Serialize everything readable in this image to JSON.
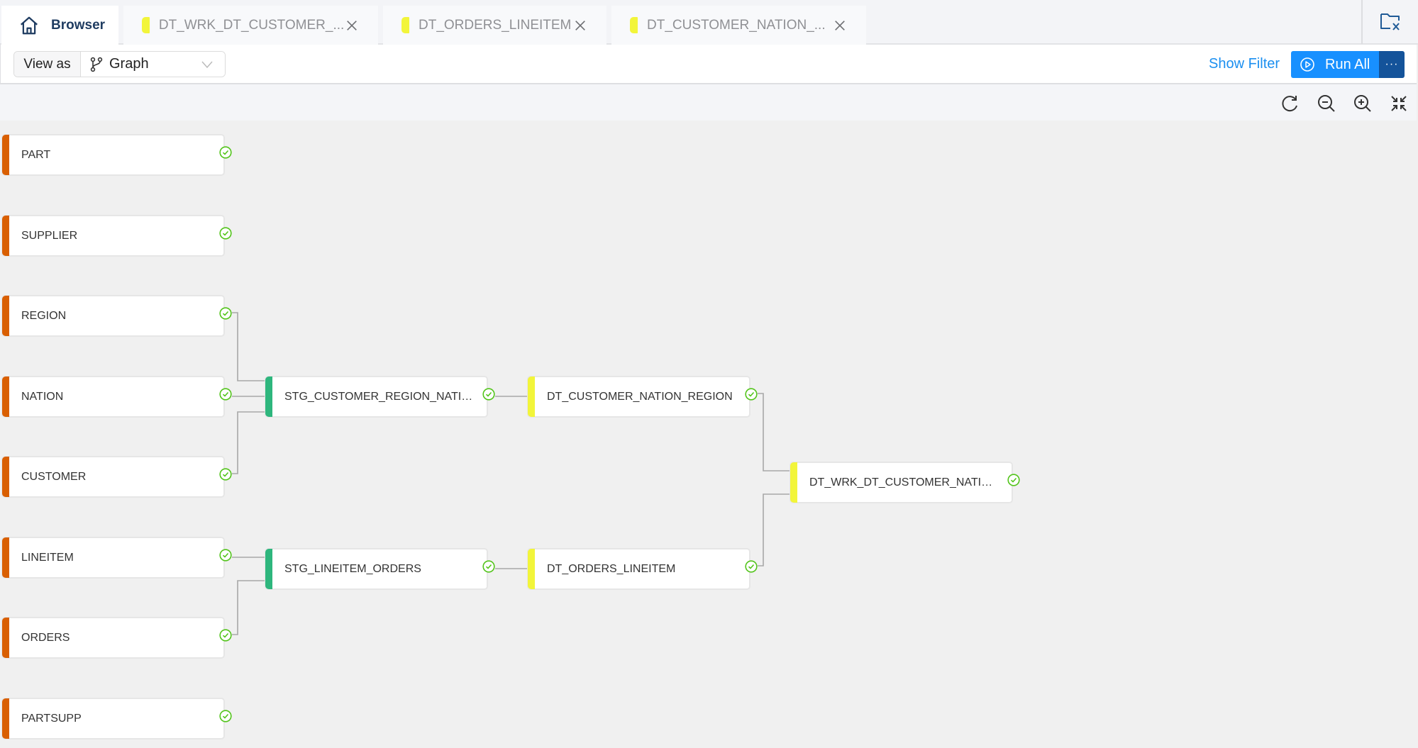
{
  "tabs": [
    {
      "label": "Browser",
      "icon": "home-icon",
      "active": true
    },
    {
      "label": "DT_WRK_DT_CUSTOMER_...",
      "icon": "dynamic-table-marker",
      "closable": true
    },
    {
      "label": "DT_ORDERS_LINEITEM",
      "icon": "dynamic-table-marker",
      "closable": true
    },
    {
      "label": "DT_CUSTOMER_NATION_...",
      "icon": "dynamic-table-marker",
      "closable": true
    }
  ],
  "toolbar": {
    "view_as_label": "View as",
    "view_as_value": "Graph",
    "show_filter": "Show Filter",
    "run_all": "Run All",
    "more": "···"
  },
  "colors": {
    "source": "#d95f02",
    "staging": "#2eb67d",
    "dynamic_table": "#f2f53a",
    "status_ok": "#52c41a",
    "primary": "#1890ff"
  },
  "graph": {
    "nodes": [
      {
        "id": "part",
        "label": "PART",
        "kind": "source",
        "status": "success"
      },
      {
        "id": "supplier",
        "label": "SUPPLIER",
        "kind": "source",
        "status": "success"
      },
      {
        "id": "region",
        "label": "REGION",
        "kind": "source",
        "status": "success"
      },
      {
        "id": "nation",
        "label": "NATION",
        "kind": "source",
        "status": "success"
      },
      {
        "id": "customer",
        "label": "CUSTOMER",
        "kind": "source",
        "status": "success"
      },
      {
        "id": "lineitem",
        "label": "LINEITEM",
        "kind": "source",
        "status": "success"
      },
      {
        "id": "orders",
        "label": "ORDERS",
        "kind": "source",
        "status": "success"
      },
      {
        "id": "partsupp",
        "label": "PARTSUPP",
        "kind": "source",
        "status": "success"
      },
      {
        "id": "stg_crn",
        "label": "STG_CUSTOMER_REGION_NATION",
        "kind": "stg",
        "status": "success"
      },
      {
        "id": "stg_lo",
        "label": "STG_LINEITEM_ORDERS",
        "kind": "stg",
        "status": "success"
      },
      {
        "id": "dt_cnr",
        "label": "DT_CUSTOMER_NATION_REGION",
        "kind": "dt",
        "status": "success"
      },
      {
        "id": "dt_ol",
        "label": "DT_ORDERS_LINEITEM",
        "kind": "dt",
        "status": "success"
      },
      {
        "id": "dt_wrk",
        "label": "DT_WRK_DT_CUSTOMER_NATION_R...",
        "kind": "dt",
        "status": "success"
      }
    ],
    "edges": [
      [
        "region",
        "stg_crn"
      ],
      [
        "nation",
        "stg_crn"
      ],
      [
        "customer",
        "stg_crn"
      ],
      [
        "lineitem",
        "stg_lo"
      ],
      [
        "orders",
        "stg_lo"
      ],
      [
        "stg_crn",
        "dt_cnr"
      ],
      [
        "stg_lo",
        "dt_ol"
      ],
      [
        "dt_cnr",
        "dt_wrk"
      ],
      [
        "dt_ol",
        "dt_wrk"
      ]
    ]
  }
}
